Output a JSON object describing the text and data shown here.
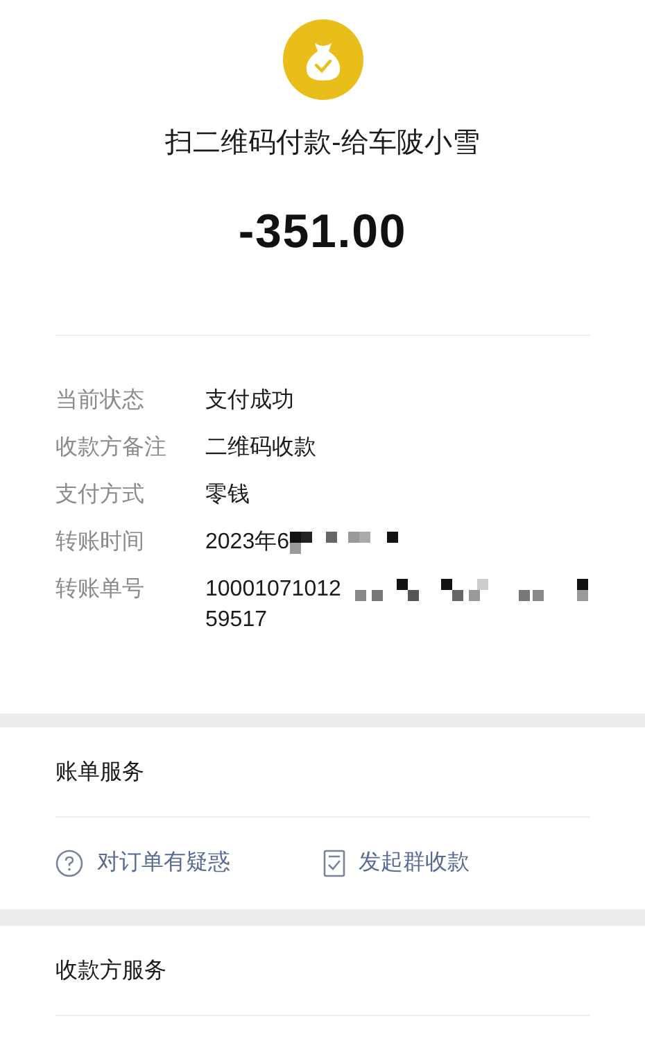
{
  "header": {
    "title": "扫二维码付款-给车陂小雪",
    "amount": "-351.00"
  },
  "details": [
    {
      "label": "当前状态",
      "value": "支付成功"
    },
    {
      "label": "收款方备注",
      "value": "二维码收款"
    },
    {
      "label": "支付方式",
      "value": "零钱"
    },
    {
      "label": "转账时间",
      "value": "2023年6",
      "redacted": true
    },
    {
      "label": "转账单号",
      "value": "10001071012",
      "redacted": true,
      "second_line": "59517"
    }
  ],
  "bill_service": {
    "title": "账单服务",
    "actions": [
      {
        "kind": "question",
        "label": "对订单有疑惑"
      },
      {
        "kind": "receipt",
        "label": "发起群收款"
      }
    ]
  },
  "payee_service": {
    "title": "收款方服务"
  }
}
